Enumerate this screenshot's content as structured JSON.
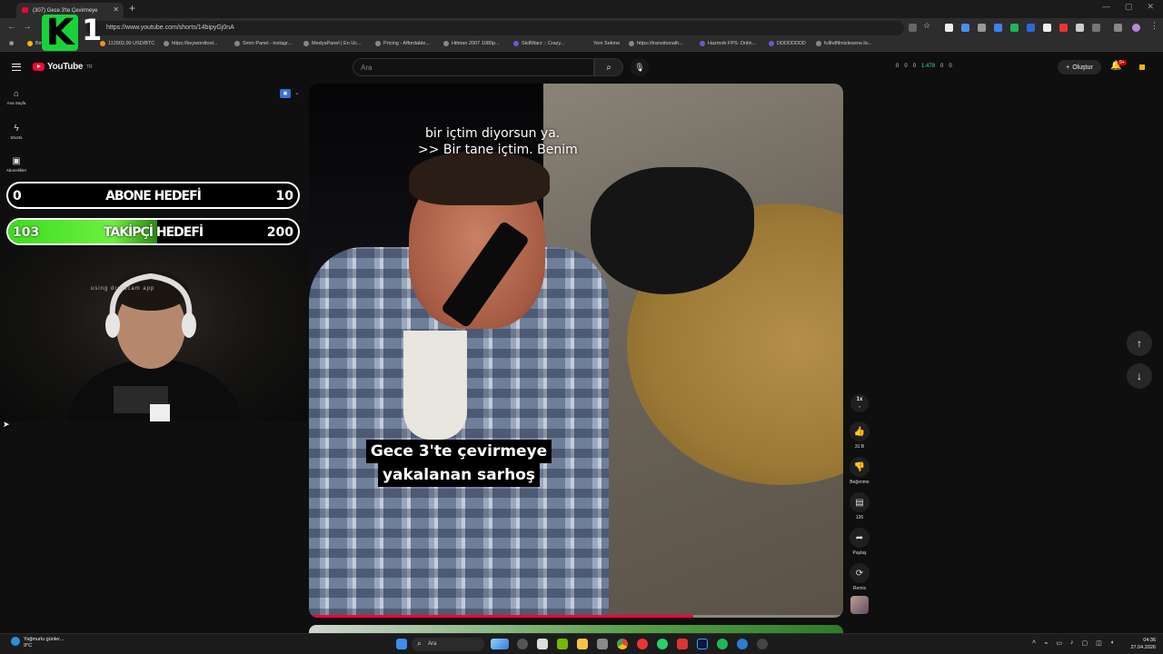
{
  "browser": {
    "tab_title": "(307) Gece 3'te Çevirmeye",
    "url": "https://www.youtube.com/shorts/14bipyGj0nA",
    "bookmarks": [
      "Binance",
      "112902,00 USD/BTC",
      "https://keywordtool...",
      "Smm Panel - instagr...",
      "MedyaPanel | En Uc...",
      "Pricing - Affordable...",
      "Hitman 2007 1080p...",
      "SkillWarz :: Crazy...",
      "Yeni Sekme",
      "https://transitionalh...",
      "Hazmob FPS: Onlin...",
      "DDDDDDDD",
      "fullhdfilmizlesene.liv..."
    ]
  },
  "youtube": {
    "logo_text": "YouTube",
    "logo_region": "TR",
    "search_placeholder": "Ara",
    "stats": [
      "0",
      "0",
      "0",
      "1.478",
      "0",
      "0"
    ],
    "create_label": "Oluştur",
    "notif_count": "9+"
  },
  "leftnav": [
    {
      "label": "Ana Sayfa",
      "icon": "home-icon"
    },
    {
      "label": "Shorts",
      "icon": "shorts-icon"
    },
    {
      "label": "Abonelikler",
      "icon": "subscriptions-icon"
    }
  ],
  "overlay": {
    "goal1": {
      "left": "0",
      "center": "ABONE HEDEFİ",
      "right": "10",
      "progress": 0
    },
    "goal2": {
      "left": "103",
      "center": "TAKİPÇİ HEDEFİ",
      "right": "200",
      "progress": 0.515
    },
    "webcam_text": "using droidcam app",
    "kbadge_letter": "K",
    "kbadge_num": "1"
  },
  "short": {
    "caption_line1": "bir içtim diyorsun ya.",
    "caption_line2": ">> Bir tane içtim. Benim",
    "title_line1": "Gece 3'te çevirmeye",
    "title_line2": "yakalanan sarhoş",
    "progress": 0.72
  },
  "actions": {
    "speed": "1x",
    "like_count": "31 B",
    "dislike_label": "Beğenme",
    "comment_count": "126",
    "share_label": "Paylaş",
    "remix_label": "Remix"
  },
  "taskbar": {
    "weather_line1": "Yağmurlu günler...",
    "weather_line2": "9°C",
    "search_label": "Ara",
    "time": "04:36",
    "date": "27.04.2026"
  },
  "colors": {
    "accent": "#ff0033",
    "goal_fill": "#3ddc1f",
    "badge_green": "#19d23a"
  }
}
